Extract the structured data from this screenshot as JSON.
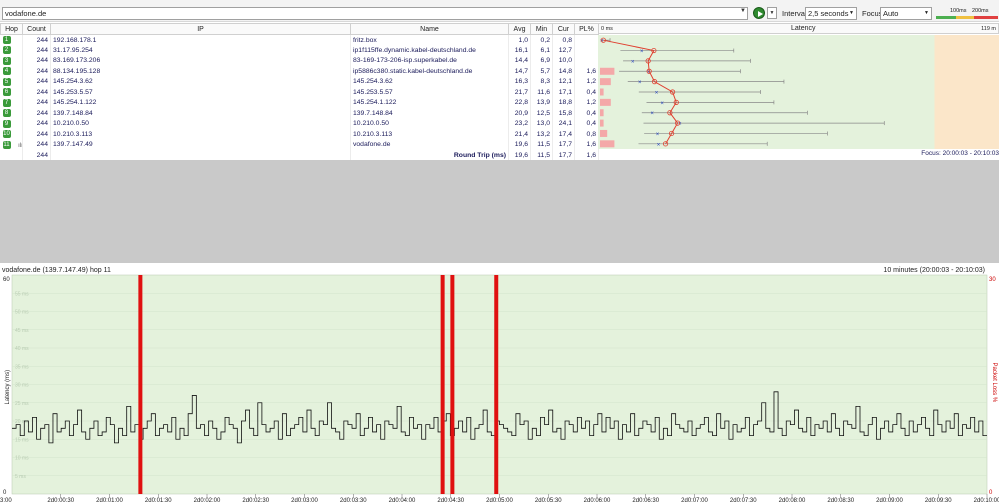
{
  "toolbar": {
    "target": "vodafone.de",
    "interval_label": "Interval",
    "interval_value": "2,5 seconds",
    "focus_label": "Focus",
    "focus_value": "Auto",
    "scale_mid": "100ms",
    "scale_high": "200ms",
    "colors": {
      "good": "#4caf50",
      "warn": "#f0c040",
      "bad": "#e04040"
    }
  },
  "table": {
    "headers": [
      "Hop",
      "Count",
      "IP",
      "Name",
      "Avg",
      "Min",
      "Cur",
      "PL%"
    ],
    "rows": [
      {
        "hop": "1",
        "count": "244",
        "ip": "192.168.178.1",
        "name": "fritz.box",
        "avg": "1,0",
        "min": "0,2",
        "cur": "0,8",
        "pl": "",
        "pl_value": 0
      },
      {
        "hop": "2",
        "count": "244",
        "ip": "31.17.95.254",
        "name": "ip1f115ffe.dynamic.kabel-deutschland.de",
        "avg": "16,1",
        "min": "6,1",
        "cur": "12,7",
        "pl": "",
        "pl_value": 0
      },
      {
        "hop": "3",
        "count": "244",
        "ip": "83.169.173.206",
        "name": "83-169-173-206-isp.superkabel.de",
        "avg": "14,4",
        "min": "6,9",
        "cur": "10,0",
        "pl": "",
        "pl_value": 0
      },
      {
        "hop": "4",
        "count": "244",
        "ip": "88.134.195.128",
        "name": "ip5886c380.static.kabel-deutschland.de",
        "avg": "14,7",
        "min": "5,7",
        "cur": "14,8",
        "pl": "1,6",
        "pl_value": 1.6
      },
      {
        "hop": "5",
        "count": "244",
        "ip": "145.254.3.62",
        "name": "145.254.3.62",
        "avg": "16,3",
        "min": "8,3",
        "cur": "12,1",
        "pl": "1,2",
        "pl_value": 1.2
      },
      {
        "hop": "6",
        "count": "244",
        "ip": "145.253.5.57",
        "name": "145.253.5.57",
        "avg": "21,7",
        "min": "11,6",
        "cur": "17,1",
        "pl": "0,4",
        "pl_value": 0.4
      },
      {
        "hop": "7",
        "count": "244",
        "ip": "145.254.1.122",
        "name": "145.254.1.122",
        "avg": "22,8",
        "min": "13,9",
        "cur": "18,8",
        "pl": "1,2",
        "pl_value": 1.2
      },
      {
        "hop": "8",
        "count": "244",
        "ip": "139.7.148.84",
        "name": "139.7.148.84",
        "avg": "20,9",
        "min": "12,5",
        "cur": "15,8",
        "pl": "0,4",
        "pl_value": 0.4
      },
      {
        "hop": "9",
        "count": "244",
        "ip": "10.210.0.50",
        "name": "10.210.0.50",
        "avg": "23,2",
        "min": "13,0",
        "cur": "24,1",
        "pl": "0,4",
        "pl_value": 0.4
      },
      {
        "hop": "10",
        "count": "244",
        "ip": "10.210.3.113",
        "name": "10.210.3.113",
        "avg": "21,4",
        "min": "13,2",
        "cur": "17,4",
        "pl": "0,8",
        "pl_value": 0.8
      },
      {
        "hop": "11",
        "count": "244",
        "ip": "139.7.147.49",
        "name": "vodafone.de",
        "avg": "19,6",
        "min": "11,5",
        "cur": "17,7",
        "pl": "1,6",
        "pl_value": 1.6
      }
    ],
    "round_trip": {
      "count": "244",
      "label": "Round Trip (ms)",
      "avg": "19,6",
      "min": "11,5",
      "cur": "17,7",
      "pl": "1,6"
    }
  },
  "latency_panel": {
    "title": "Latency",
    "zero_label": "0 ms",
    "max_label": "119 m",
    "focus_text": "Focus: 20:00:03 - 20:10:03",
    "max_ms": [
      3,
      40,
      45,
      42,
      55,
      48,
      52,
      62,
      85,
      68,
      50
    ]
  },
  "chart": {
    "title": "vodafone.de (139.7.147.49) hop 11",
    "range": "10 minutes (20:00:03 - 20:10:03)",
    "ylabel": "Latency (ms)",
    "y2label": "Packet Loss %",
    "y_max_label": "60",
    "y_min_label": "0",
    "y2_max_label": "30",
    "y2_min_label": "0",
    "y_ticks": [
      "55 ms",
      "50 ms",
      "45 ms",
      "40 ms",
      "35 ms",
      "30 ms",
      "25 ms",
      "20 ms",
      "15 ms",
      "10 ms",
      "5 ms"
    ],
    "x_ticks": [
      "2d0:00:30",
      "2d0:01:00",
      "2d0:01:30",
      "2d0:02:00",
      "2d0:02:30",
      "2d0:03:00",
      "2d0:03:30",
      "2d0:04:00",
      "2d0:04:30",
      "2d0:05:00",
      "2d0:05:30",
      "2d0:06:00",
      "2d0:06:30",
      "2d0:07:00",
      "2d0:07:30",
      "2d0:08:00",
      "2d0:08:30",
      "2d0:09:00",
      "2d0:09:30",
      "2d0:10:00"
    ],
    "x_start_label": "3:00"
  },
  "chart_data": {
    "type": "line",
    "title": "vodafone.de (139.7.147.49) hop 11",
    "xlabel": "",
    "ylabel": "Latency (ms)",
    "y2label": "Packet Loss %",
    "ylim": [
      0,
      60
    ],
    "y2lim": [
      0,
      30
    ],
    "x_range_seconds": [
      0,
      600
    ],
    "series": [
      {
        "values": [
          18,
          19,
          16,
          20,
          17,
          21,
          15,
          18,
          19,
          14,
          22,
          17,
          18,
          20,
          16,
          19,
          23,
          17,
          15,
          18,
          20,
          16,
          17,
          21,
          19,
          14,
          18,
          16,
          24,
          17,
          19,
          15,
          18,
          20,
          22,
          16,
          18,
          19,
          17,
          21,
          15,
          18,
          16,
          22,
          27,
          18,
          19,
          16,
          20,
          18,
          15,
          17,
          21,
          19,
          18,
          14,
          20,
          23,
          18,
          16,
          25,
          19,
          17,
          18,
          20,
          15,
          22,
          16,
          18,
          19,
          21,
          17,
          23,
          18,
          16,
          20,
          19,
          25,
          18,
          17,
          15,
          20,
          19,
          18,
          22,
          16,
          18,
          21,
          17,
          19,
          15,
          20,
          19,
          18,
          24,
          17,
          16,
          21,
          18,
          19,
          15,
          19,
          18,
          21,
          17,
          20,
          22,
          16,
          18,
          20,
          17,
          21,
          15,
          18,
          19,
          23,
          17,
          16,
          20,
          19,
          18,
          17,
          16,
          22,
          19,
          20,
          15,
          18,
          16,
          21,
          19,
          23,
          17,
          18,
          15,
          20,
          19,
          17,
          21,
          18,
          20,
          16,
          19,
          22,
          17,
          21,
          18,
          20,
          15,
          19,
          17,
          22,
          16,
          18,
          20,
          19,
          17,
          21,
          15,
          18,
          16,
          22,
          19,
          18,
          17,
          20,
          16,
          18,
          19,
          21,
          17,
          16,
          22,
          18,
          20,
          15,
          19,
          17,
          18,
          21,
          16,
          19,
          20,
          25,
          18,
          17,
          28,
          18,
          16,
          20,
          19,
          23,
          18,
          17,
          21,
          16,
          19,
          18,
          20,
          17,
          22,
          18,
          16,
          20,
          19,
          18,
          24,
          17,
          16,
          19,
          21,
          15,
          18,
          20,
          17,
          19,
          22,
          18,
          16,
          20,
          17,
          19,
          21,
          18,
          16,
          23,
          19,
          17,
          20,
          18,
          22,
          16,
          19,
          18,
          21,
          17,
          20,
          16
        ]
      },
      {
        "name": "Packet Loss %",
        "loss_at_seconds": [
          79,
          265,
          271,
          298
        ],
        "loss_percent": [
          30,
          30,
          30,
          30
        ]
      }
    ]
  }
}
